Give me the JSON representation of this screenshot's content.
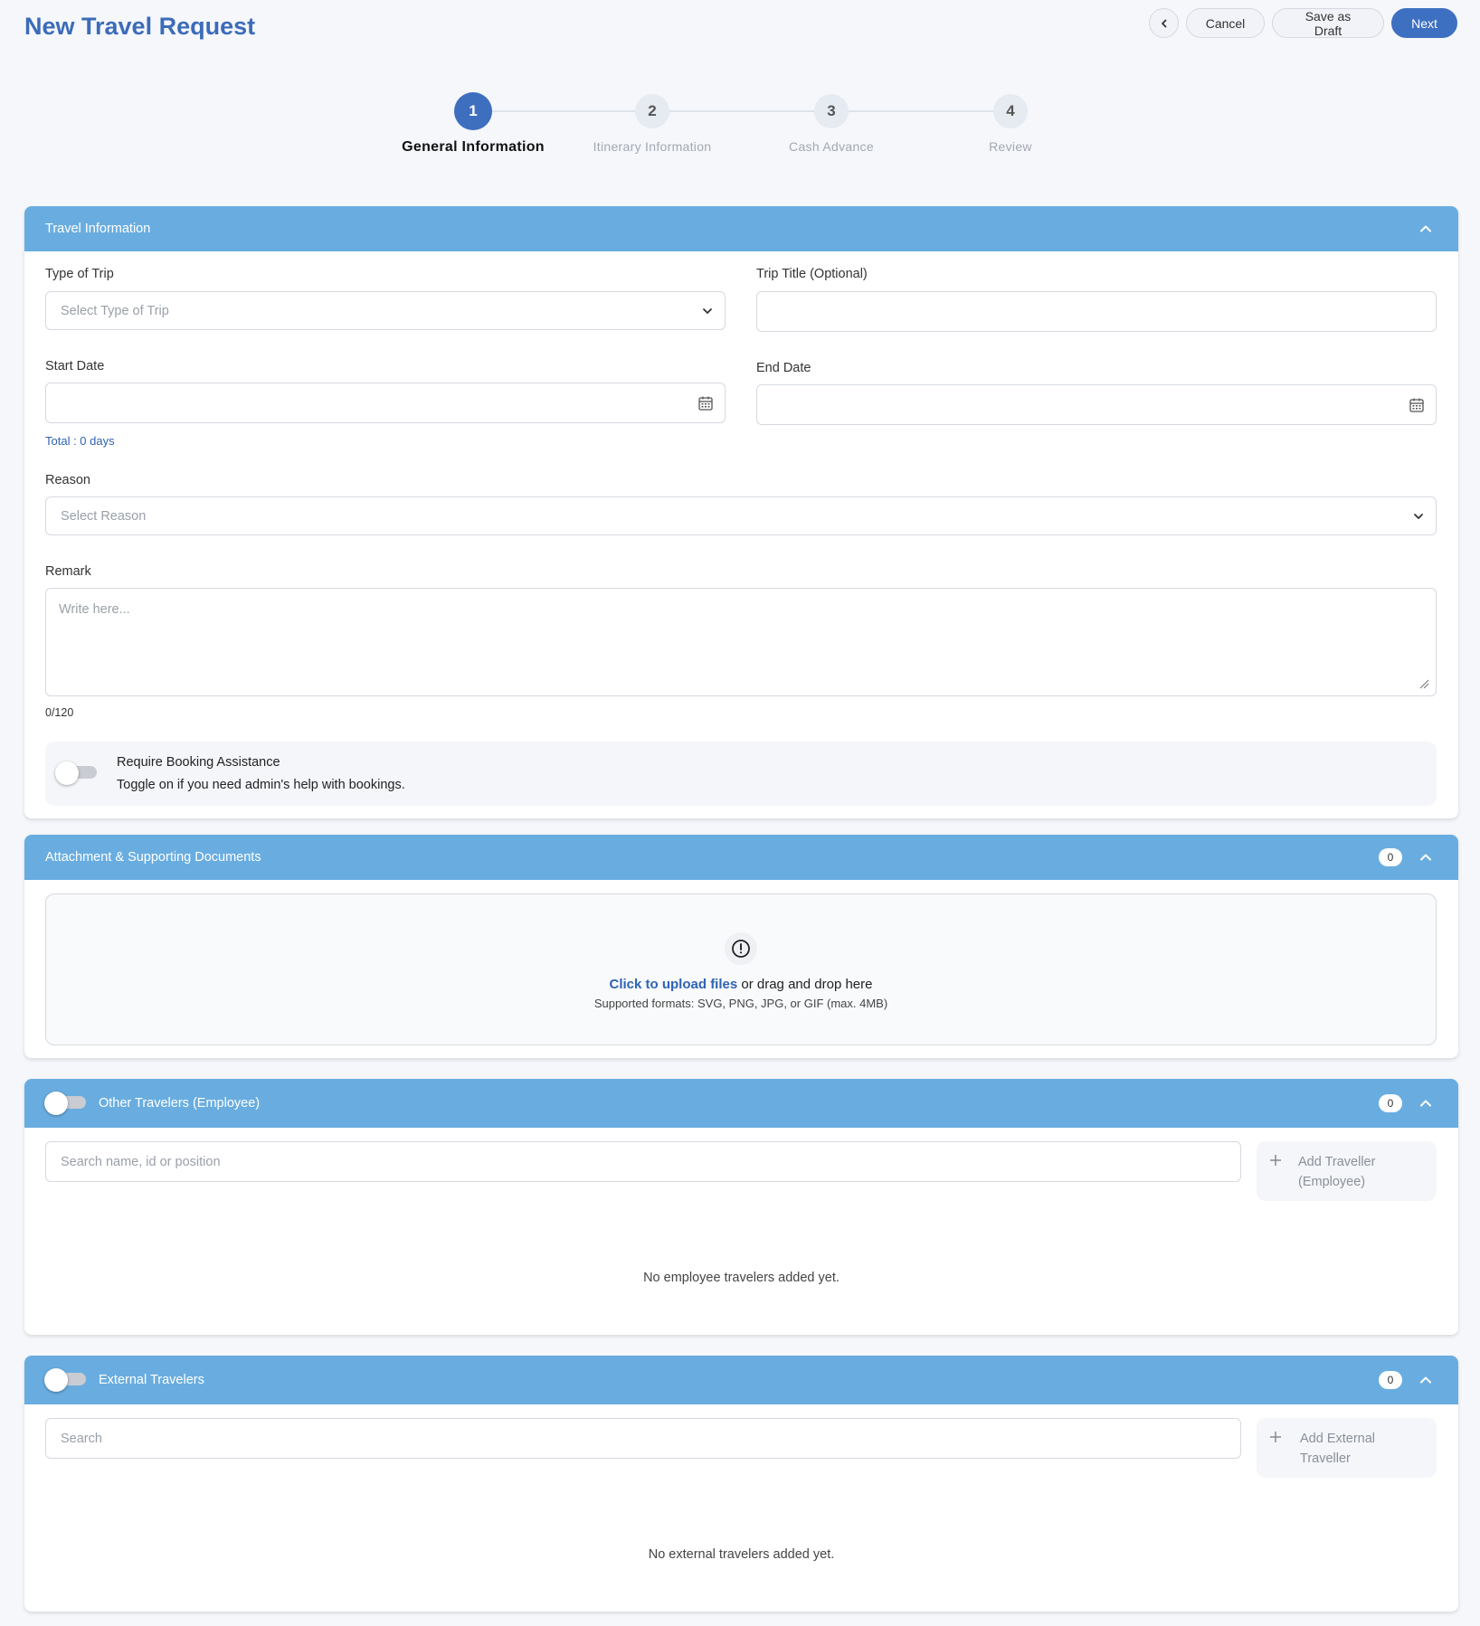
{
  "page": {
    "title": "New Travel Request"
  },
  "header": {
    "back_icon": "chevron-left-icon",
    "cancel_label": "Cancel",
    "draft_label": "Save as Draft",
    "next_label": "Next"
  },
  "stepper": {
    "active": 1,
    "steps": [
      {
        "number": "1",
        "label": "General Information"
      },
      {
        "number": "2",
        "label": "Itinerary Information"
      },
      {
        "number": "3",
        "label": "Cash Advance"
      },
      {
        "number": "4",
        "label": "Review"
      }
    ]
  },
  "travel_info": {
    "title": "Travel Information",
    "type_of_trip": {
      "label": "Type of Trip",
      "placeholder": "Select Type of Trip"
    },
    "trip_title": {
      "label": "Trip Title (Optional)",
      "value": ""
    },
    "start_date": {
      "label": "Start Date",
      "value": ""
    },
    "end_date": {
      "label": "End Date",
      "value": ""
    },
    "total": "Total : 0 days",
    "reason": {
      "label": "Reason",
      "placeholder": "Select Reason"
    },
    "remark": {
      "label": "Remark",
      "placeholder": "Write here...",
      "counter": "0/120"
    },
    "booking": {
      "title": "Require Booking Assistance",
      "description": "Toggle on if you need admin's help with bookings.",
      "enabled": false
    }
  },
  "attachments": {
    "title": "Attachment & Supporting Documents",
    "count": "0",
    "upload_link": "Click to upload files",
    "upload_text": " or drag and drop here",
    "formats": "Supported formats: SVG, PNG, JPG, or GIF (max. 4MB)",
    "icon": "info-circle-icon"
  },
  "employees": {
    "title": "Other Travelers (Employee)",
    "count": "0",
    "enabled": false,
    "search_placeholder": "Search name, id or position",
    "add_label": "Add Traveller (Employee)",
    "empty": "No employee travelers added yet."
  },
  "externals": {
    "title": "External Travelers",
    "count": "0",
    "enabled": false,
    "search_placeholder": "Search",
    "add_label": "Add External Traveller",
    "empty": "No external travelers added yet."
  },
  "colors": {
    "accent": "#3e70c2",
    "section_header": "#69ade0",
    "title": "#3c6cb8",
    "link": "#2f63b4"
  }
}
